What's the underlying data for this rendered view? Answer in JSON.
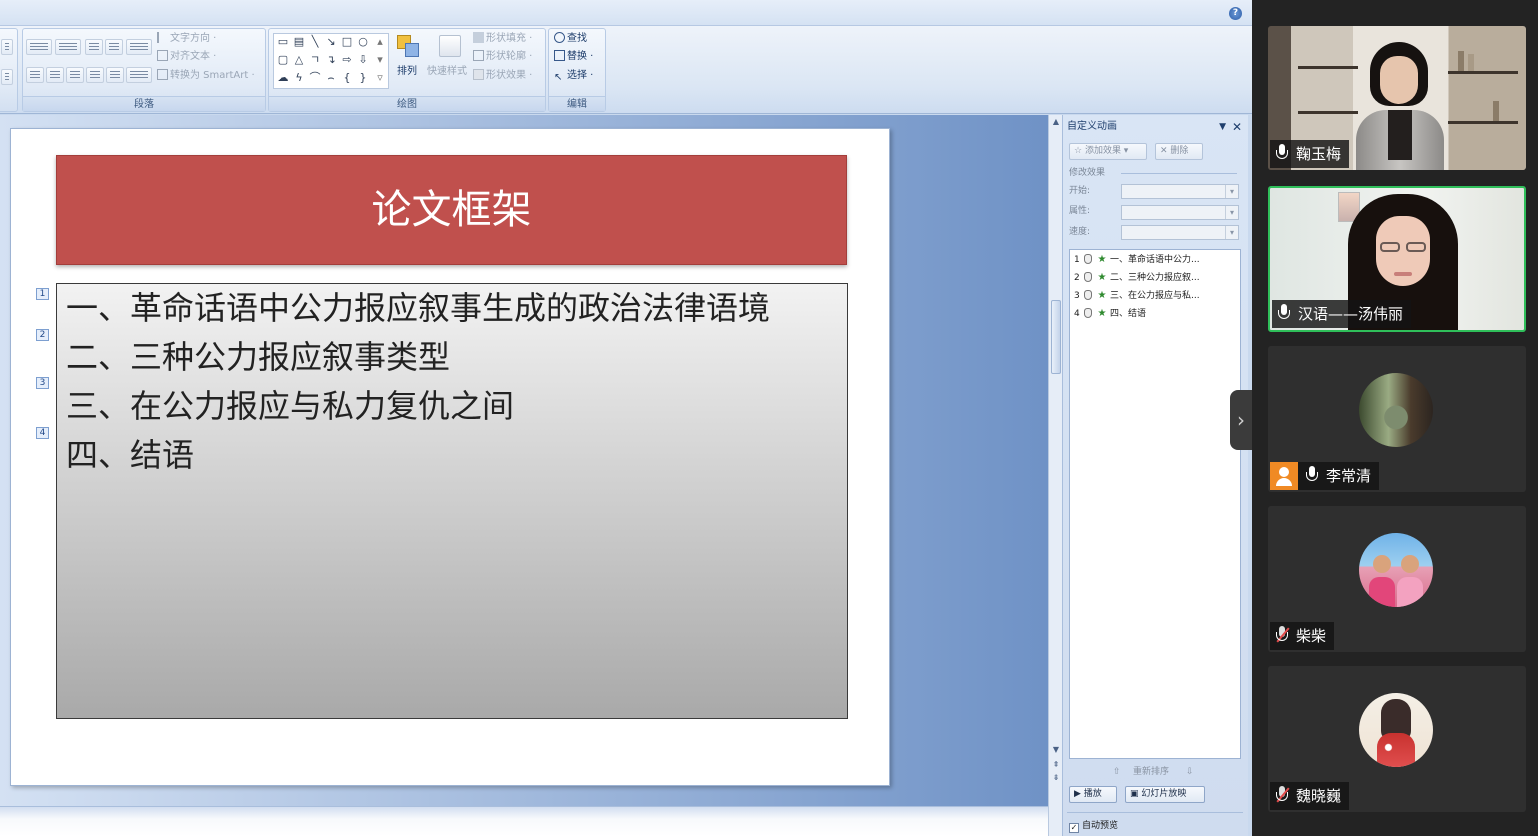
{
  "ribbon": {
    "paragraph": {
      "label": "段落",
      "text_direction": "文字方向 ·",
      "align_text": "对齐文本 ·",
      "convert_smartart": "转换为 SmartArt ·"
    },
    "drawing": {
      "label": "绘图",
      "arrange": "排列",
      "quick_styles": "快速样式",
      "shape_fill": "形状填充 ·",
      "shape_outline": "形状轮廓 ·",
      "shape_effects": "形状效果 ·"
    },
    "editing": {
      "label": "编辑",
      "find": "查找",
      "replace": "替换 ·",
      "select": "选择 ·"
    }
  },
  "slide": {
    "title": "论文框架",
    "outline": [
      {
        "tag": "1",
        "text": "一、革命话语中公力报应叙事生成的政治法律语境"
      },
      {
        "tag": "2",
        "text": "二、三种公力报应叙事类型"
      },
      {
        "tag": "3",
        "text": "三、在公力报应与私力复仇之间"
      },
      {
        "tag": "4",
        "text": "四、结语"
      }
    ]
  },
  "custom_animation": {
    "title": "自定义动画",
    "add_effect": "添加效果 ▾",
    "remove": "删除",
    "modify_label": "修改效果",
    "start_label": "开始:",
    "property_label": "属性:",
    "speed_label": "速度:",
    "items": [
      {
        "num": "1",
        "text": "一、革命话语中公力..."
      },
      {
        "num": "2",
        "text": "二、三种公力报应叙..."
      },
      {
        "num": "3",
        "text": "三、在公力报应与私..."
      },
      {
        "num": "4",
        "text": "四、结语"
      }
    ],
    "reorder_label": "重新排序",
    "play": "播放",
    "slideshow": "幻灯片放映",
    "autopreview": "自动预览"
  },
  "meeting": {
    "participants": [
      {
        "name": "鞠玉梅",
        "muted": false,
        "speaking": false
      },
      {
        "name": "汉语——汤伟丽",
        "muted": false,
        "speaking": true
      },
      {
        "name": "李常清",
        "muted": false,
        "host": true
      },
      {
        "name": "柴柴",
        "muted": true
      },
      {
        "name": "魏晓巍",
        "muted": true
      }
    ]
  },
  "colors": {
    "title_bar": "#c0504d",
    "active_speaker_border": "#2fbf5a",
    "host_badge": "#f08a24"
  }
}
